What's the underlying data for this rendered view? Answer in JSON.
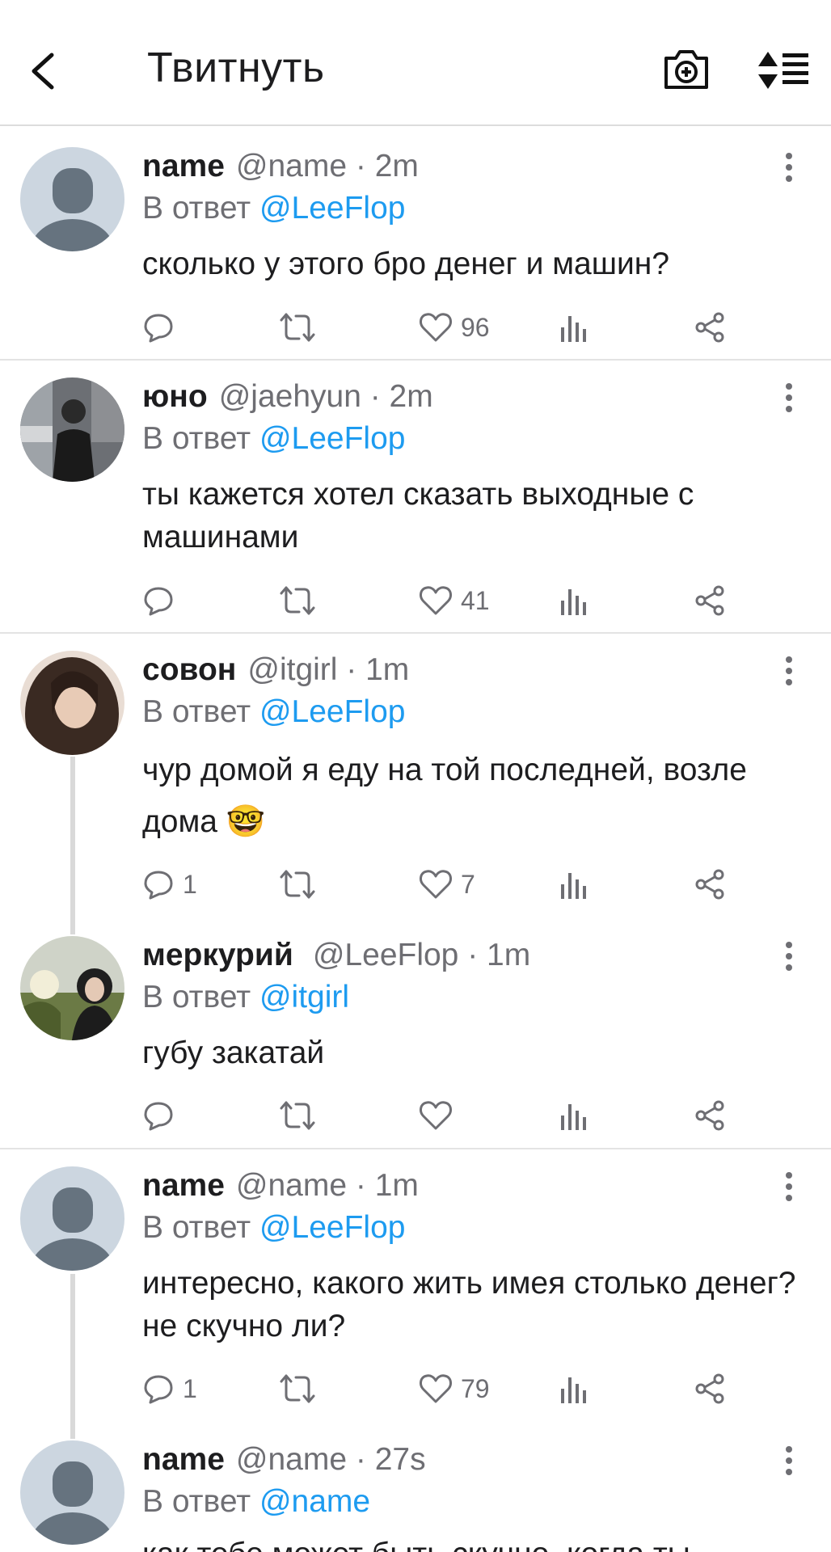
{
  "header": {
    "title": "Твитнуть"
  },
  "tweets": [
    {
      "name": "name",
      "handle": "@name · 2m",
      "reply_prefix": "В ответ",
      "reply_to": "@LeeFlop",
      "text": "сколько у этого бро денег и машин?",
      "replies": "",
      "likes": "96",
      "avatar": "default-avatar"
    },
    {
      "name": "юно",
      "handle": "@jaehyun · 2m",
      "reply_prefix": "В ответ",
      "reply_to": "@LeeFlop",
      "text": "ты кажется хотел сказать выходные с машинами",
      "replies": "",
      "likes": "41",
      "avatar": "photo-avatar"
    },
    {
      "name": "совон",
      "handle": "@itgirl · 1m",
      "reply_prefix": "В ответ",
      "reply_to": "@LeeFlop",
      "text": "чур домой я еду на той последней, возле дома 🤓",
      "replies": "1",
      "likes": "7",
      "avatar": "photo-avatar"
    },
    {
      "name": "меркурий",
      "handle": "@LeeFlop · 1m",
      "reply_prefix": "В ответ",
      "reply_to": "@itgirl",
      "text": "губу закатай",
      "replies": "",
      "likes": "",
      "avatar": "photo-avatar"
    },
    {
      "name": "name",
      "handle": "@name · 1m",
      "reply_prefix": "В ответ",
      "reply_to": "@LeeFlop",
      "text": "интересно, какого жить имея столько денег? не скучно ли?",
      "replies": "1",
      "likes": "79",
      "avatar": "default-avatar"
    },
    {
      "name": "name",
      "handle": "@name · 27s",
      "reply_prefix": "В ответ",
      "reply_to": "@name",
      "text": "как тебе может быть скучно, когда ты",
      "replies": "",
      "likes": "",
      "avatar": "default-avatar"
    }
  ],
  "colors": {
    "accent": "#1d9bf0",
    "text": "#1d1d1f",
    "muted": "#6e6e73",
    "divider": "#e3e3e3"
  }
}
